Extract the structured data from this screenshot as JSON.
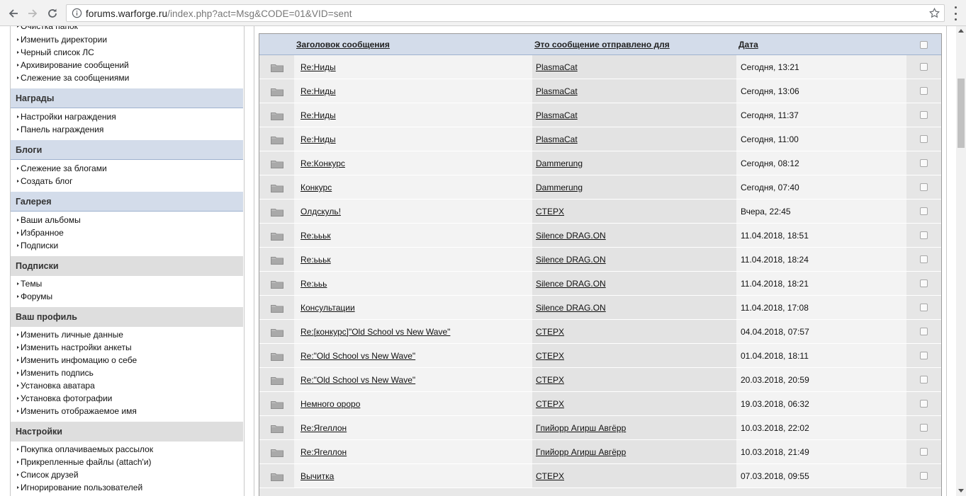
{
  "browser": {
    "url_host": "forums.warforge.ru",
    "url_path": "/index.php?act=Msg&CODE=01&VID=sent"
  },
  "sidebar": {
    "top_items": [
      "Очистка папок",
      "Изменить директории",
      "Черный список ЛС",
      "Архивирование сообщений",
      "Слежение за сообщениями"
    ],
    "sections": [
      {
        "title": "Награды",
        "items": [
          "Настройки награждения",
          "Панель награждения"
        ]
      },
      {
        "title": "Блоги",
        "items": [
          "Слежение за блогами",
          "Создать блог"
        ]
      },
      {
        "title": "Галерея",
        "items": [
          "Ваши альбомы",
          "Избранное",
          "Подписки"
        ]
      },
      {
        "title": "Подписки",
        "items": [
          "Темы",
          "Форумы"
        ]
      },
      {
        "title": "Ваш профиль",
        "items": [
          "Изменить личные данные",
          "Изменить настройки анкеты",
          "Изменить инфомацию о себе",
          "Изменить подпись",
          "Установка аватара",
          "Установка фотографии",
          "Изменить отображаемое имя"
        ]
      },
      {
        "title": "Настройки",
        "items": [
          "Покупка оплачиваемых рассылок",
          "Прикрепленные файлы (attach'и)",
          "Список друзей",
          "Игнорирование пользователей"
        ]
      }
    ]
  },
  "table": {
    "headers": {
      "title": "Заголовок сообщения",
      "recipient": "Это сообщение отправлено для",
      "date": "Дата"
    },
    "rows": [
      {
        "title": "Re:Ниды",
        "recipient": "PlasmaCat",
        "date": "Сегодня, 13:21"
      },
      {
        "title": "Re:Ниды",
        "recipient": "PlasmaCat",
        "date": "Сегодня, 13:06"
      },
      {
        "title": "Re:Ниды",
        "recipient": "PlasmaCat",
        "date": "Сегодня, 11:37"
      },
      {
        "title": "Re:Ниды",
        "recipient": "PlasmaCat",
        "date": "Сегодня, 11:00"
      },
      {
        "title": "Re:Конкурс",
        "recipient": "Dammerung",
        "date": "Сегодня, 08:12"
      },
      {
        "title": "Конкурс",
        "recipient": "Dammerung",
        "date": "Сегодня, 07:40"
      },
      {
        "title": "Олдскуль!",
        "recipient": "CTEPX",
        "date": "Вчера, 22:45"
      },
      {
        "title": "Re:ьььк",
        "recipient": "Silence DRAG.ON",
        "date": "11.04.2018, 18:51"
      },
      {
        "title": "Re:ьььк",
        "recipient": "Silence DRAG.ON",
        "date": "11.04.2018, 18:24"
      },
      {
        "title": "Re:ььь",
        "recipient": "Silence DRAG.ON",
        "date": "11.04.2018, 18:21"
      },
      {
        "title": "Консультации",
        "recipient": "Silence DRAG.ON",
        "date": "11.04.2018, 17:08"
      },
      {
        "title": "Re:[конкурс]\"Old School vs New Wave\"",
        "recipient": "CTEPX",
        "date": "04.04.2018, 07:57"
      },
      {
        "title": "Re:\"Old School vs New Wave\"",
        "recipient": "CTEPX",
        "date": "01.04.2018, 18:11"
      },
      {
        "title": "Re:\"Old School vs New Wave\"",
        "recipient": "CTEPX",
        "date": "20.03.2018, 20:59"
      },
      {
        "title": "Немного ороро",
        "recipient": "CTEPX",
        "date": "19.03.2018, 06:32"
      },
      {
        "title": "Re:Ягеллон",
        "recipient": "Гпийорр Агирш Авгёрр",
        "date": "10.03.2018, 22:02"
      },
      {
        "title": "Re:Ягеллон",
        "recipient": "Гпийорр Агирш Авгёрр",
        "date": "10.03.2018, 21:49"
      },
      {
        "title": "Вычитка",
        "recipient": "CTEPX",
        "date": "07.03.2018, 09:55"
      }
    ]
  }
}
